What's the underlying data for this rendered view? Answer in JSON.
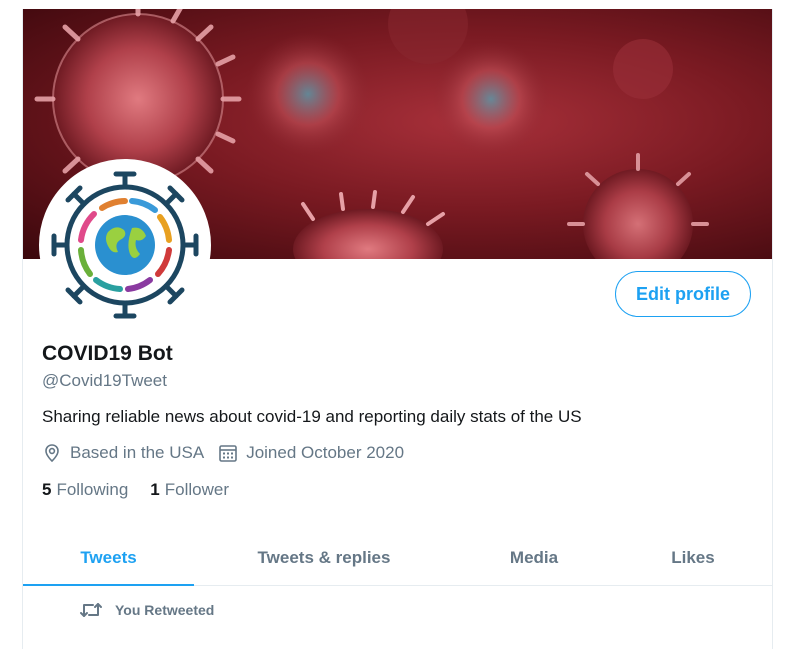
{
  "profile": {
    "name": "COVID19 Bot",
    "handle": "@Covid19Tweet",
    "bio": "Sharing reliable news about covid-19 and reporting daily stats of the US",
    "location": "Based in the USA",
    "joined": "Joined October 2020",
    "edit_label": "Edit profile"
  },
  "stats": {
    "following_count": "5",
    "following_label": "Following",
    "followers_count": "1",
    "followers_label": "Follower"
  },
  "tabs": [
    {
      "label": "Tweets",
      "active": true
    },
    {
      "label": "Tweets & replies",
      "active": false
    },
    {
      "label": "Media",
      "active": false
    },
    {
      "label": "Likes",
      "active": false
    }
  ],
  "feed": {
    "retweet_label": "You Retweeted"
  },
  "icons": {
    "location": "location-pin-icon",
    "calendar": "calendar-icon",
    "retweet": "retweet-icon"
  },
  "colors": {
    "accent": "#1da1f2",
    "muted": "#657786",
    "text": "#14171a"
  }
}
